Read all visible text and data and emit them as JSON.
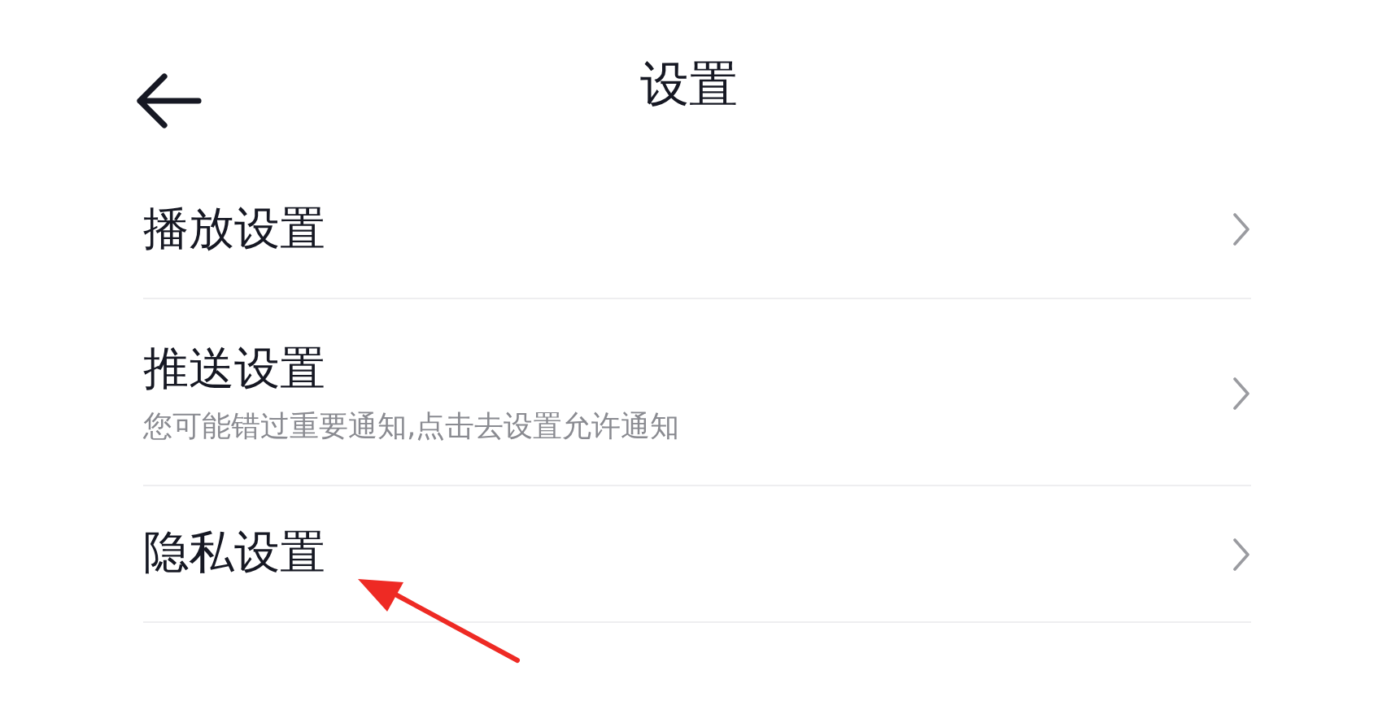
{
  "header": {
    "title": "设置"
  },
  "rows": [
    {
      "title": "播放设置"
    },
    {
      "title": "推送设置",
      "subtitle": "您可能错过重要通知,点击去设置允许通知"
    },
    {
      "title": "隐私设置"
    }
  ]
}
